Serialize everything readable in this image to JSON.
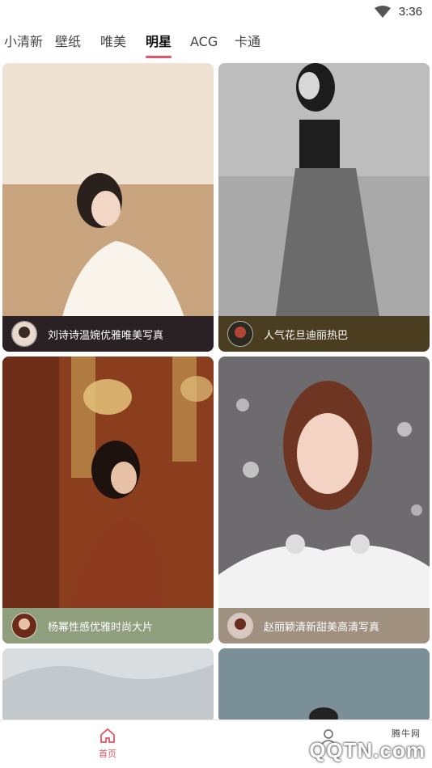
{
  "status": {
    "time": "3:36",
    "wifi_icon": "wifi-icon"
  },
  "tabs": [
    {
      "label": "小清新",
      "active": false
    },
    {
      "label": "壁纸",
      "active": false
    },
    {
      "label": "唯美",
      "active": false
    },
    {
      "label": "明星",
      "active": true
    },
    {
      "label": "ACG",
      "active": false
    },
    {
      "label": "卡通",
      "active": false
    }
  ],
  "cards": [
    {
      "title": "刘诗诗温婉优雅唯美写真",
      "caption_color": "#2a2124"
    },
    {
      "title": "人气花旦迪丽热巴",
      "caption_color": "#4a3d20"
    },
    {
      "title": "杨幂性感优雅时尚大片",
      "caption_color": "#8f9e7c"
    },
    {
      "title": "赵丽颖清新甜美高清写真",
      "caption_color": "#9f9080"
    }
  ],
  "bottom_nav": {
    "home_label": "首页",
    "home_icon": "home-icon",
    "profile_icon": "profile-icon"
  },
  "watermark": {
    "text": "QQTN.com",
    "sub": "腾牛网"
  },
  "accent_color": "#e25563"
}
